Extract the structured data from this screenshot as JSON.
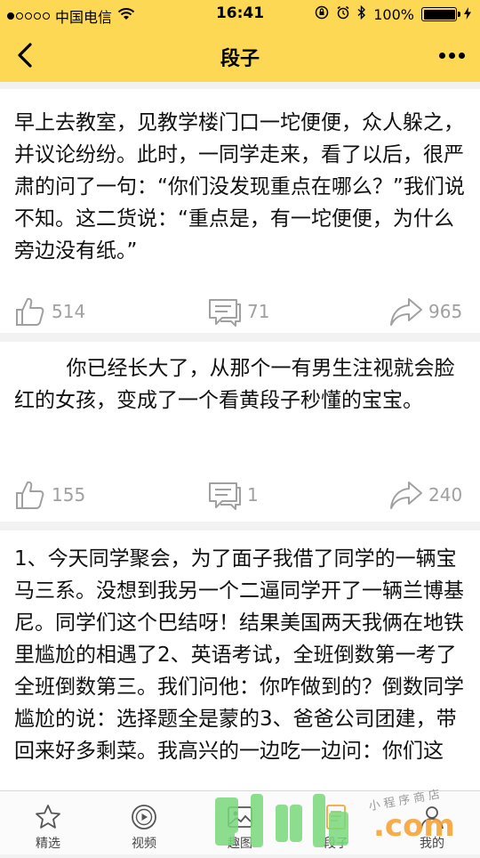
{
  "status_bar": {
    "carrier": "中国电信",
    "time": "16:41",
    "battery": "100%"
  },
  "nav": {
    "title": "段子"
  },
  "posts": [
    {
      "text": "早上去教室，见教学楼门口一坨便便，众人躲之，并议论纷纷。此时，一同学走来，看了以后，很严肃的问了一句：“你们没发现重点在哪么？”我们说不知。这二货说：“重点是，有一坨便便，为什么旁边没有纸。”",
      "likes": "514",
      "comments": "71",
      "shares": "965"
    },
    {
      "text": "        你已经长大了，从那个一有男生注视就会脸红的女孩，变成了一个看黄段子秒懂的宝宝。",
      "likes": "155",
      "comments": "1",
      "shares": "240"
    },
    {
      "text": "1、今天同学聚会，为了面子我借了同学的一辆宝马三系。没想到我另一个二逼同学开了一辆兰博基尼。同学们这个巴结呀！结果美国两天我俩在地铁里尴尬的相遇了2、英语考试，全班倒数第一考了全班倒数第三。我们问他：你咋做到的？倒数同学尴尬的说：选择题全是蒙的3、爸爸公司团建，带回来好多剩菜。我高兴的一边吃一边问：你们这"
    }
  ],
  "tabs": [
    {
      "label": "精选",
      "icon": "star-icon"
    },
    {
      "label": "视频",
      "icon": "play-icon"
    },
    {
      "label": "趣图",
      "icon": "image-icon"
    },
    {
      "label": "段子",
      "icon": "text-icon"
    },
    {
      "label": "我的",
      "icon": "person-icon"
    }
  ],
  "watermark": {
    "text": "小程序商店",
    "domain": ".com"
  },
  "colors": {
    "header_bg": "#fcd854",
    "page_bg": "#f2f2f2",
    "action_gray": "#a0a0a0",
    "watermark_green": "#79d97c",
    "watermark_orange": "#f7a43a"
  }
}
